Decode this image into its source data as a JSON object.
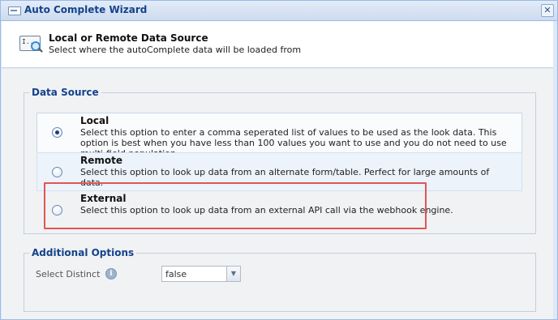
{
  "window": {
    "title": "Auto Complete Wizard",
    "close_glyph": "✕"
  },
  "header": {
    "icon_text": "I...",
    "title": "Local or Remote Data Source",
    "subtitle": "Select where the autoComplete data will be loaded from"
  },
  "data_source": {
    "legend": "Data Source",
    "selected": "local",
    "options": [
      {
        "id": "local",
        "title": "Local",
        "description": "Select this option to enter a comma seperated list of values to be used as the look data. This option is best when you have less than 100 values you want to use and you do not need to use multi-field population."
      },
      {
        "id": "remote",
        "title": "Remote",
        "description": "Select this option to look up data from an alternate form/table. Perfect for large amounts of data."
      },
      {
        "id": "external",
        "title": "External",
        "description": "Select this option to look up data from an external API call via the webhook engine."
      }
    ]
  },
  "additional_options": {
    "legend": "Additional Options",
    "select_distinct": {
      "label": "Select Distinct",
      "info_glyph": "i",
      "value": "false",
      "dropdown_glyph": "▼"
    }
  },
  "colors": {
    "title": "#15428b",
    "highlight": "#e05555",
    "window_border": "#99bbe8"
  },
  "icons": [
    "window-icon",
    "close-icon",
    "data-source-search-icon",
    "radio-icon",
    "info-icon",
    "dropdown-arrow-icon"
  ]
}
